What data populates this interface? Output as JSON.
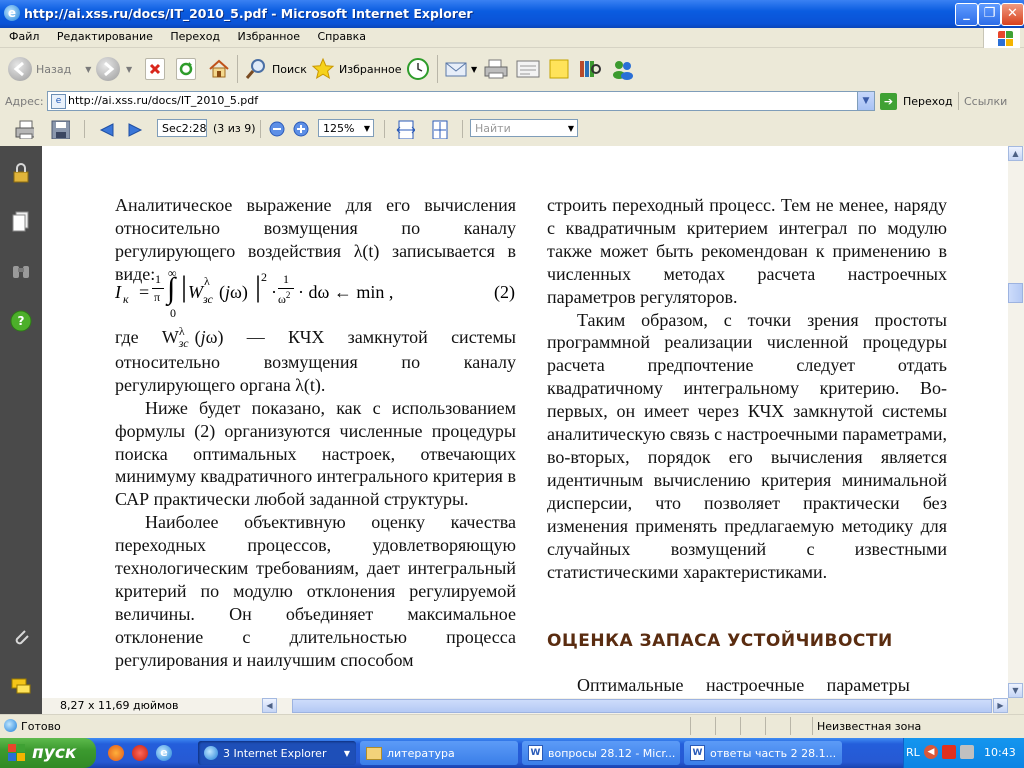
{
  "window": {
    "title": "http://ai.xss.ru/docs/IT_2010_5.pdf - Microsoft Internet Explorer"
  },
  "menu": [
    "Файл",
    "Редактирование",
    "Переход",
    "Избранное",
    "Справка"
  ],
  "toolbar": {
    "back_label": "Назад",
    "search_label": "Поиск",
    "favorites_label": "Избранное"
  },
  "address": {
    "label": "Адрес:",
    "url": "http://ai.xss.ru/docs/IT_2010_5.pdf",
    "go_label": "Переход",
    "links_label": "Ссылки"
  },
  "pdf_toolbar": {
    "page_field": "Sec2:28",
    "page_info": "(3 из 9)",
    "zoom": "125%",
    "find_placeholder": "Найти"
  },
  "document": {
    "left_col": {
      "para1": "Аналитическое выражение для его вычисления относительно возмущения по каналу регулирующего воздействия λ(t) записывается в виде:",
      "formula_lhs": "I",
      "formula_sub": "к",
      "formula_tail": "· dω ← min ,",
      "formula_number": "(2)",
      "para2": "где  W",
      "para2_rest": "— КЧХ замкнутой системы относительно возмущения по каналу регулирующего органа λ(t).",
      "para3": "Ниже будет показано, как с использованием формулы (2) организуются численные процедуры поиска оптимальных настроек, отвечающих минимуму квадратичного интегрального критерия в САР практически любой заданной структуры.",
      "para4": "Наиболее объективную оценку качества переходных процессов, удовлетворяющую технологическим требованиям, дает интегральный критерий по модулю отклонения регулируемой величины. Он объединяет максимальное отклонение с длительностью процесса регулирования и наилучшим способом"
    },
    "right_col": {
      "para1": "строить переходный процесс. Тем не менее, наряду с квадратичным критерием интеграл по модулю также может быть рекомендован к применению в численных методах расчета настроечных параметров регуляторов.",
      "para2": "Таким образом, с точки зрения простоты программной реализации численной процедуры расчета предпочтение следует отдать квадратичному интегральному критерию. Во-первых, он имеет через КЧХ замкнутой системы аналитическую связь с настроечными параметрами, во-вторых, порядок его вычисления является идентичным вычислению критерия минимальной дисперсии, что позволяет практически без изменения применять предлагаемую методику для случайных возмущений с известными статистическими характеристиками.",
      "heading": "ОЦЕНКА ЗАПАСА УСТОЙЧИВОСТИ",
      "para3": "Оптимальные     настроечные     параметры"
    }
  },
  "page_size": "8,27 x 11,69 дюймов",
  "status": {
    "text": "Готово",
    "zone": "Неизвестная зона"
  },
  "taskbar": {
    "start_label": "пуск",
    "tasks": [
      {
        "label": "3 Internet Explorer",
        "active": true
      },
      {
        "label": "литература",
        "active": false
      },
      {
        "label": "вопросы 28.12 - Micr...",
        "active": false
      },
      {
        "label": "ответы часть 2 28.1...",
        "active": false
      }
    ],
    "lang": "RL",
    "clock": "10:43"
  }
}
